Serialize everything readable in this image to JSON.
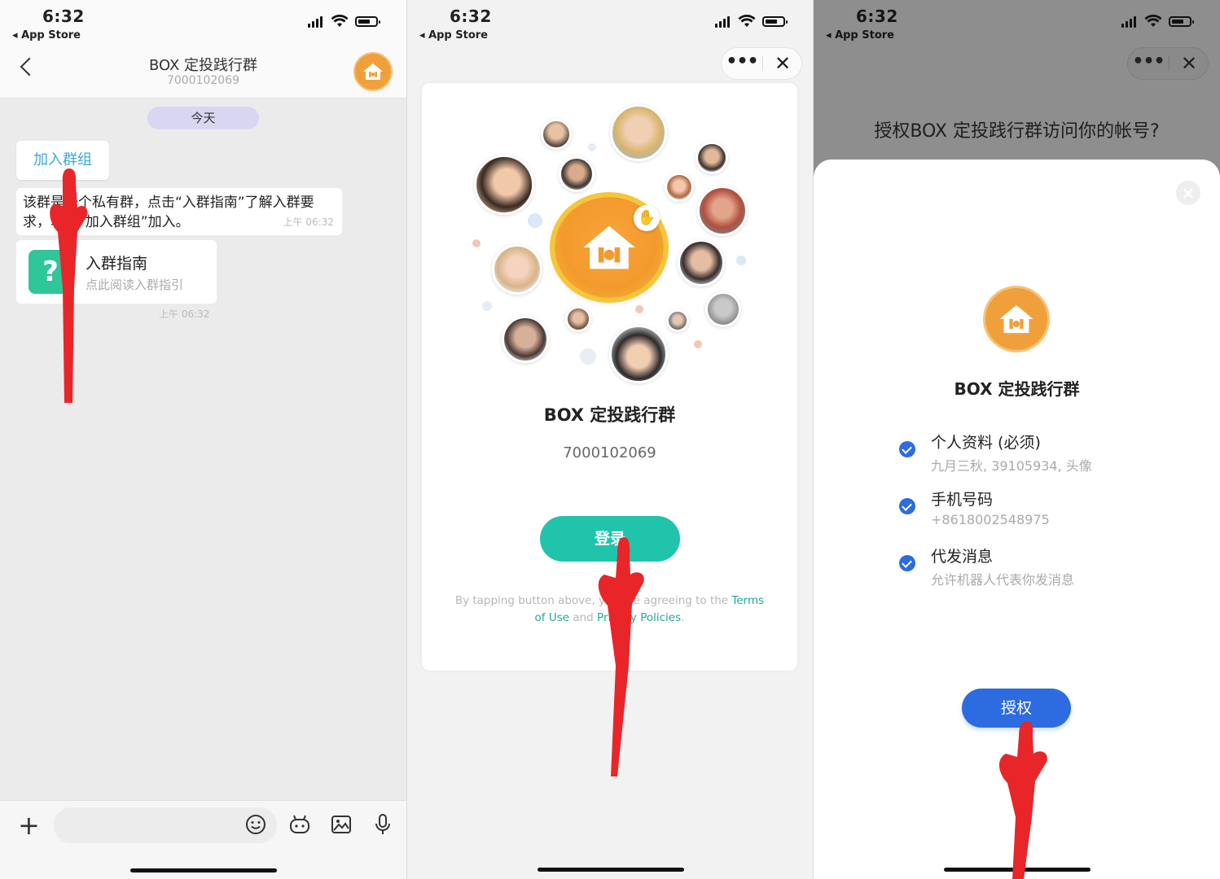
{
  "status": {
    "time": "6:32",
    "back_app": "App Store"
  },
  "chat": {
    "title": "BOX 定投践行群",
    "id": "7000102069",
    "date_divider": "今天",
    "join_button": "加入群组",
    "message": "该群是一个私有群，点击“入群指南”了解入群要求，轻按“加入群组”加入。",
    "message_time": "上午 06:32",
    "card_title": "入群指南",
    "card_desc": "点此阅读入群指引",
    "card_time": "上午 06:32",
    "input_placeholder": ""
  },
  "login": {
    "group_name": "BOX 定投践行群",
    "group_id": "7000102069",
    "login_button": "登录",
    "terms_prefix": "By tapping button above, you are agreeing to the ",
    "terms_link": "Terms of Use",
    "terms_and": " and ",
    "privacy_link": "Privacy Policies",
    "terms_suffix": "."
  },
  "auth": {
    "question": "授权BOX 定投践行群访问你的帐号?",
    "app_name": "BOX 定投践行群",
    "permissions": [
      {
        "title": "个人资料 (必须)",
        "desc": "九月三秋, 39105934, 头像"
      },
      {
        "title": "手机号码",
        "desc": "+8618002548975"
      },
      {
        "title": "代发消息",
        "desc": "允许机器人代表你发消息"
      }
    ],
    "authorize_button": "授权"
  },
  "colors": {
    "accent_teal": "#21c4ab",
    "accent_blue": "#2c6be0",
    "brand_orange": "#f0a03a",
    "pointer_red": "#e8262a"
  },
  "icons": [
    "back-chevron-icon",
    "group-logo-icon",
    "help-icon",
    "plus-icon",
    "emoji-icon",
    "robot-icon",
    "image-icon",
    "mic-icon",
    "more-icon",
    "close-icon",
    "check-icon",
    "hand-pointer-icon"
  ]
}
